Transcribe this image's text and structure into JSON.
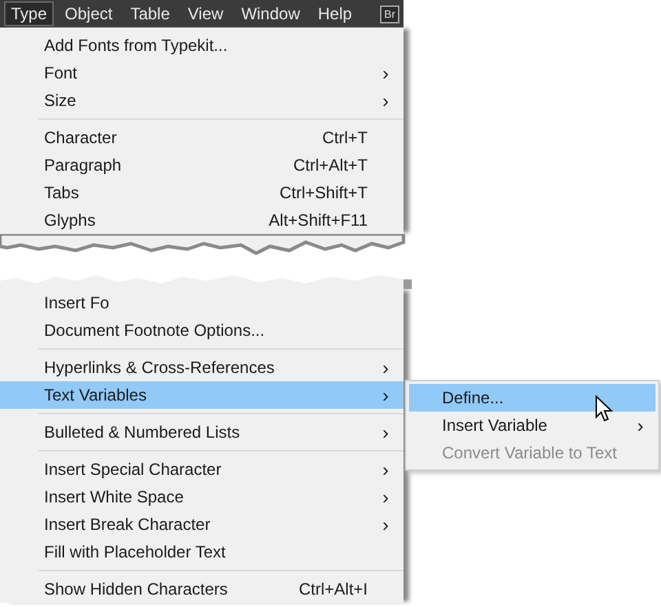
{
  "menubar": {
    "items": [
      {
        "label": "Type",
        "selected": true
      },
      {
        "label": "Object",
        "selected": false
      },
      {
        "label": "Table",
        "selected": false
      },
      {
        "label": "View",
        "selected": false
      },
      {
        "label": "Window",
        "selected": false
      },
      {
        "label": "Help",
        "selected": false
      }
    ],
    "badge": "Br"
  },
  "menu_top": [
    {
      "kind": "item",
      "label": "Add Fonts from Typekit...",
      "submenu": false,
      "selected": false
    },
    {
      "kind": "item",
      "label": "Font",
      "submenu": true,
      "selected": false
    },
    {
      "kind": "item",
      "label": "Size",
      "submenu": true,
      "selected": false
    },
    {
      "kind": "separator"
    },
    {
      "kind": "item",
      "label": "Character",
      "shortcut": "Ctrl+T",
      "submenu": false,
      "selected": false
    },
    {
      "kind": "item",
      "label": "Paragraph",
      "shortcut": "Ctrl+Alt+T",
      "submenu": false,
      "selected": false
    },
    {
      "kind": "item",
      "label": "Tabs",
      "shortcut": "Ctrl+Shift+T",
      "submenu": false,
      "selected": false
    },
    {
      "kind": "item",
      "label": "Glyphs",
      "shortcut": "Alt+Shift+F11",
      "submenu": false,
      "selected": false
    }
  ],
  "menu_bottom": [
    {
      "kind": "item",
      "label": "Insert Fo",
      "submenu": false,
      "selected": false
    },
    {
      "kind": "item",
      "label": "Document Footnote Options...",
      "submenu": false,
      "selected": false
    },
    {
      "kind": "separator"
    },
    {
      "kind": "item",
      "label": "Hyperlinks & Cross-References",
      "submenu": true,
      "selected": false
    },
    {
      "kind": "item",
      "label": "Text Variables",
      "submenu": true,
      "selected": true
    },
    {
      "kind": "separator"
    },
    {
      "kind": "item",
      "label": "Bulleted & Numbered Lists",
      "submenu": true,
      "selected": false
    },
    {
      "kind": "separator"
    },
    {
      "kind": "item",
      "label": "Insert Special Character",
      "submenu": true,
      "selected": false
    },
    {
      "kind": "item",
      "label": "Insert White Space",
      "submenu": true,
      "selected": false
    },
    {
      "kind": "item",
      "label": "Insert Break Character",
      "submenu": true,
      "selected": false
    },
    {
      "kind": "item",
      "label": "Fill with Placeholder Text",
      "submenu": false,
      "selected": false
    },
    {
      "kind": "separator"
    },
    {
      "kind": "item",
      "label": "Show Hidden Characters",
      "shortcut": "Ctrl+Alt+I",
      "submenu": false,
      "selected": false
    }
  ],
  "submenu": [
    {
      "label": "Define...",
      "submenu": false,
      "selected": true,
      "disabled": false
    },
    {
      "label": "Insert Variable",
      "submenu": true,
      "selected": false,
      "disabled": false
    },
    {
      "label": "Convert Variable to Text",
      "submenu": false,
      "selected": false,
      "disabled": true
    }
  ],
  "chevron": "›"
}
